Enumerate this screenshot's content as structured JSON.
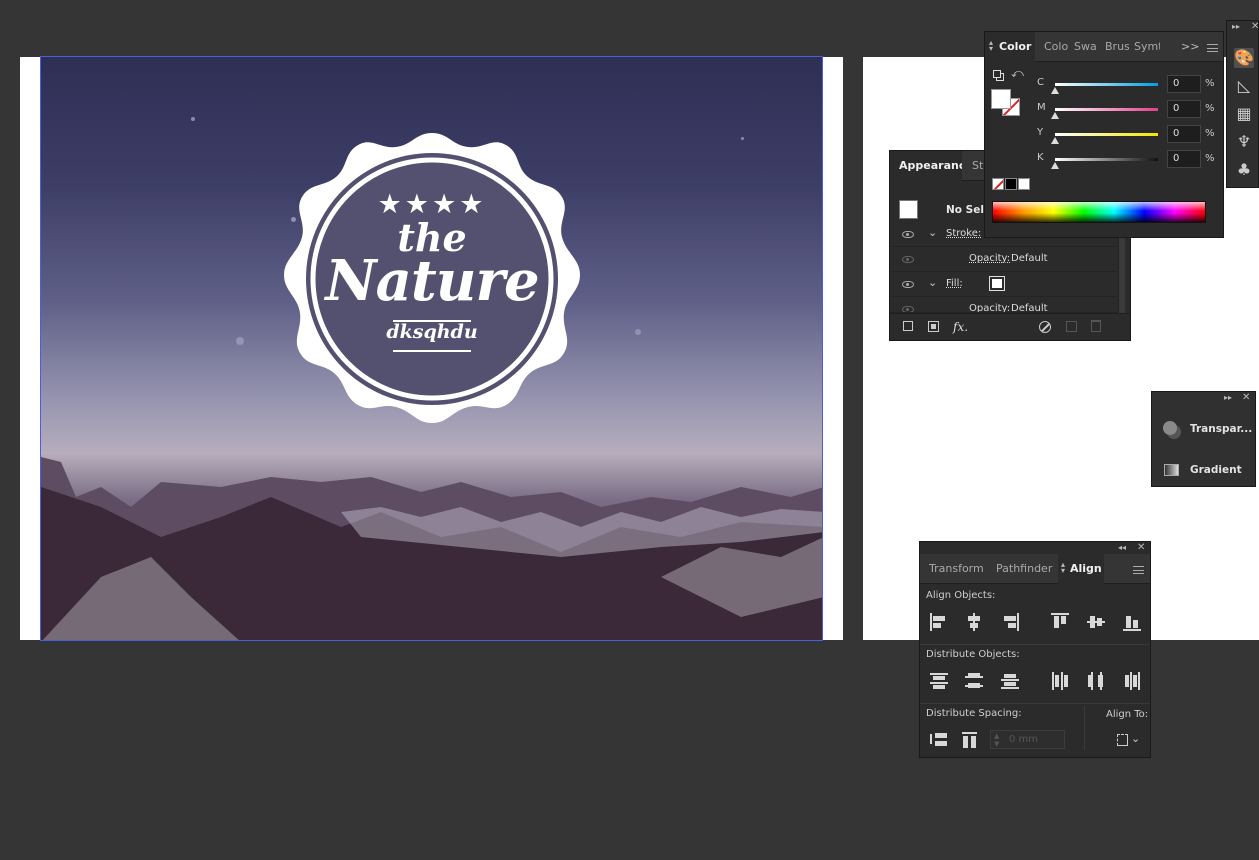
{
  "artboard": {
    "badge": {
      "stars": "★★★★",
      "line1": "the",
      "line2": "Nature",
      "line3": "dksqhdu"
    }
  },
  "color_panel": {
    "tabs": [
      "Color",
      "Colo",
      "Swa",
      "Brus",
      "Symt"
    ],
    "overflow": ">>",
    "sliders": [
      {
        "label": "C",
        "value": "0",
        "unit": "%",
        "gradient": [
          "#ffffff",
          "#00a0e0"
        ]
      },
      {
        "label": "M",
        "value": "0",
        "unit": "%",
        "gradient": [
          "#ffffff",
          "#e0408a"
        ]
      },
      {
        "label": "Y",
        "value": "0",
        "unit": "%",
        "gradient": [
          "#ffffff",
          "#f0e800"
        ]
      },
      {
        "label": "K",
        "value": "0",
        "unit": "%",
        "gradient": [
          "#ffffff",
          "#111111"
        ]
      }
    ]
  },
  "appearance_panel": {
    "tabs": [
      "Appearance",
      "St"
    ],
    "header": "No Sele",
    "rows": [
      {
        "label": "Stroke:"
      },
      {
        "label": "Opacity:",
        "value": "Default"
      },
      {
        "label": "Fill:"
      },
      {
        "label": "Opacity:",
        "value": "Default"
      }
    ],
    "fx_label": "fx."
  },
  "tg_panel": {
    "items": [
      "Transpar...",
      "Gradient"
    ]
  },
  "align_panel": {
    "tabs": [
      "Transform",
      "Pathfinder",
      "Align"
    ],
    "sections": {
      "align_objects": "Align Objects:",
      "distribute_objects": "Distribute Objects:",
      "distribute_spacing": "Distribute Spacing:",
      "align_to": "Align To:"
    },
    "spacing_placeholder": "0 mm"
  },
  "colors": {
    "accent_selection": "#4a5ee0",
    "workspace": "#353535",
    "panel": "#2b2b2b"
  }
}
